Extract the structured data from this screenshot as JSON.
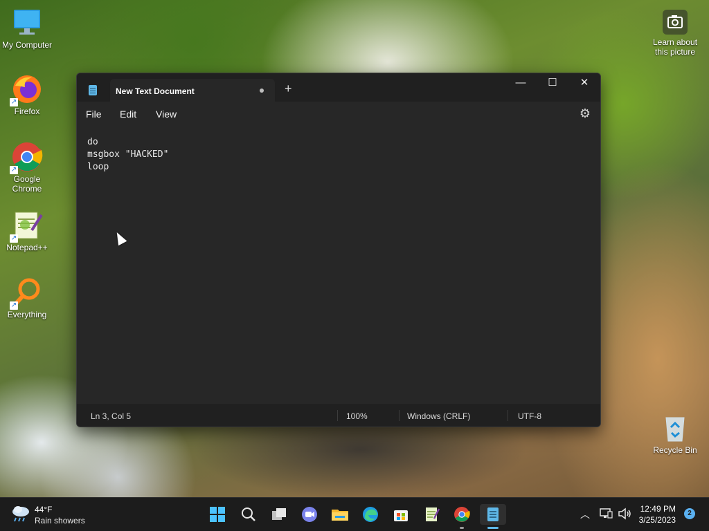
{
  "desktop": {
    "icons": [
      {
        "label": "My Computer",
        "icon": "monitor-icon"
      },
      {
        "label": "Firefox",
        "icon": "firefox-icon"
      },
      {
        "label": "Google Chrome",
        "icon": "chrome-icon"
      },
      {
        "label": "Notepad++",
        "icon": "notepadpp-icon"
      },
      {
        "label": "Everything",
        "icon": "everything-icon"
      }
    ],
    "learn_about": "Learn about this picture",
    "recycle_bin": "Recycle Bin"
  },
  "notepad": {
    "tab_title": "New Text Document",
    "new_tab": "+",
    "controls": {
      "minimize": "—",
      "maximize": "☐",
      "close": "✕"
    },
    "menu": {
      "file": "File",
      "edit": "Edit",
      "view": "View"
    },
    "content": "do\nmsgbox \"HACKED\"\nloop",
    "status": {
      "position": "Ln 3, Col 5",
      "zoom": "100%",
      "line_ending": "Windows (CRLF)",
      "encoding": "UTF-8"
    }
  },
  "taskbar": {
    "weather": {
      "temp": "44°F",
      "desc": "Rain showers"
    },
    "clock": {
      "time": "12:49 PM",
      "date": "3/25/2023"
    },
    "notification_count": "2",
    "tray_chevron": "^"
  },
  "colors": {
    "accent": "#5fb8e8",
    "window_bg": "#272727",
    "titlebar_bg": "#202020"
  }
}
